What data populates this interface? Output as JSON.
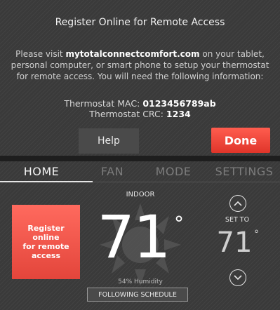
{
  "dialog": {
    "title": "Register Online for Remote Access",
    "line1_prefix": "Please visit ",
    "line1_link": "mytotalconnectcomfort.com",
    "line1_suffix": " on your tablet,",
    "line2": "personal computer, or smart phone to setup your thermostat",
    "line3": "for remote access.  You will need the following information:",
    "mac_label": "Thermostat MAC: ",
    "mac_value": "0123456789ab",
    "crc_label": "Thermostat CRC: ",
    "crc_value": "1234",
    "help_label": "Help",
    "done_label": "Done"
  },
  "tabs": [
    {
      "label": "HOME",
      "active": true
    },
    {
      "label": "FAN",
      "active": false
    },
    {
      "label": "MODE",
      "active": false
    },
    {
      "label": "SETTINGS",
      "active": false
    }
  ],
  "home": {
    "register_label": "Register online\nfor remote\naccess",
    "indoor_label": "INDOOR",
    "indoor_temp": "71",
    "degree_symbol": "°",
    "humidity": "54% Humidity",
    "schedule_label": "FOLLOWING SCHEDULE",
    "set_to_label": "SET TO",
    "setpoint_temp": "71",
    "up_icon": "chevron-up-circle-icon",
    "down_icon": "chevron-down-circle-icon",
    "sun_icon": "sun-icon"
  },
  "colors": {
    "accent_red": "#e8453b",
    "background": "#3a3a3a"
  }
}
